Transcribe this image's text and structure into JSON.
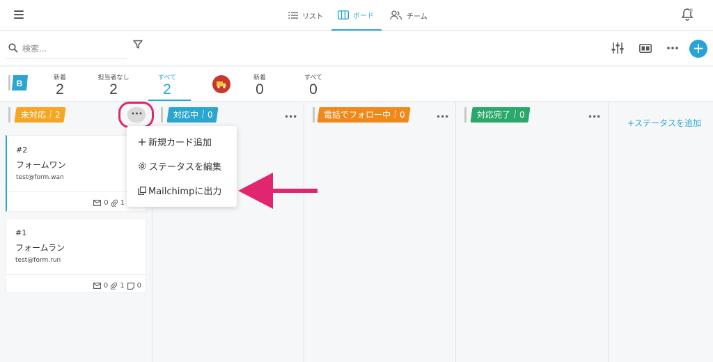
{
  "nav": {
    "tabs": [
      {
        "label": "リスト",
        "icon": "list-icon"
      },
      {
        "label": "ボード",
        "icon": "board-icon"
      },
      {
        "label": "チーム",
        "icon": "team-icon"
      }
    ],
    "active_tab": "ボード"
  },
  "search": {
    "placeholder": "検索..."
  },
  "stats": {
    "group1": {
      "badge": "B",
      "items": [
        {
          "label": "新着",
          "value": "2"
        },
        {
          "label": "担当者なし",
          "value": "2"
        },
        {
          "label": "すべて",
          "value": "2"
        }
      ]
    },
    "group2": {
      "items": [
        {
          "label": "新着",
          "value": "0"
        },
        {
          "label": "すべて",
          "value": "0"
        }
      ]
    }
  },
  "columns": [
    {
      "name": "未対応",
      "count": "2",
      "color": "#f5a623"
    },
    {
      "name": "対応中",
      "count": "0",
      "color": "#2aa6d0"
    },
    {
      "name": "電話でフォロー中",
      "count": "0",
      "color": "#f0891a"
    },
    {
      "name": "対応完了",
      "count": "0",
      "color": "#2aa869"
    }
  ],
  "cards": [
    {
      "id": "#2",
      "name": "フォームワン",
      "email": "test@form.wan",
      "mail_count": "0",
      "attach_count": "1"
    },
    {
      "id": "#1",
      "name": "フォームラン",
      "email": "test@form.run",
      "mail_count": "0",
      "attach_count": "1",
      "note_count": "0"
    }
  ],
  "menu": {
    "items": [
      {
        "label": "新規カード追加",
        "icon": "plus-icon"
      },
      {
        "label": "ステータスを編集",
        "icon": "gear-icon"
      },
      {
        "label": "Mailchimpに出力",
        "icon": "copy-icon"
      }
    ]
  },
  "add_status_label": "+ステータスを追加",
  "colors": {
    "accent": "#2aa6d0",
    "highlight": "#e0266f"
  }
}
